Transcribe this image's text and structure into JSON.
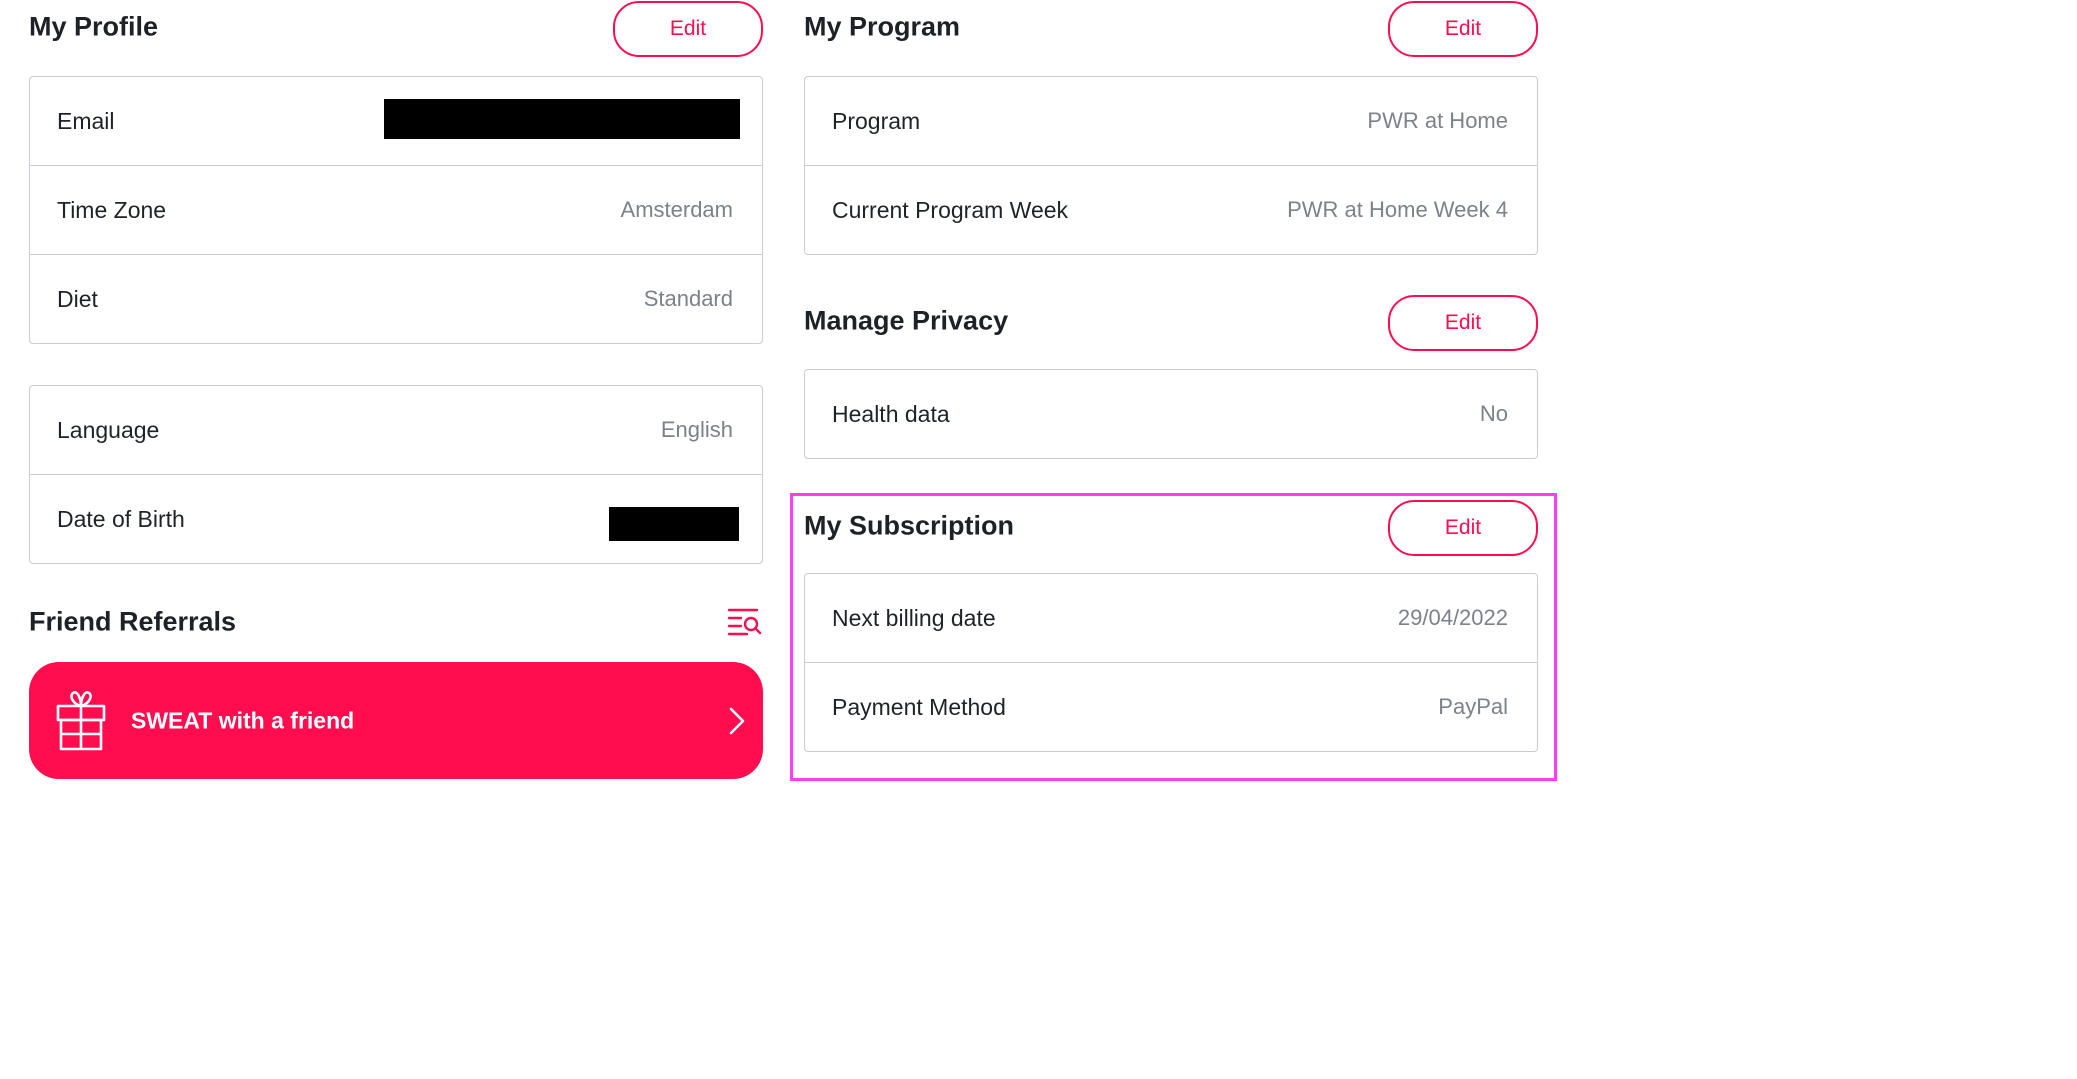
{
  "colors": {
    "accent": "#ff0d4f",
    "highlight": "#ff3df7",
    "text_primary": "#1f2328",
    "text_secondary": "#7d818a",
    "border": "#c9ccd3"
  },
  "profile": {
    "title": "My Profile",
    "edit_label": "Edit",
    "rows": [
      {
        "label": "Email",
        "value": null
      },
      {
        "label": "Time Zone",
        "value": "Amsterdam"
      },
      {
        "label": "Diet",
        "value": "Standard"
      }
    ],
    "rows2": [
      {
        "label": "Language",
        "value": "English"
      },
      {
        "label": "Date of Birth",
        "value": null
      }
    ]
  },
  "referrals": {
    "title": "Friend Referrals",
    "icon": "list-search-icon",
    "card_label": "SWEAT with a friend",
    "card_icon": "gift-icon",
    "card_arrow": "chevron-right-icon"
  },
  "program": {
    "title": "My Program",
    "edit_label": "Edit",
    "rows": [
      {
        "label": "Program",
        "value": "PWR at Home"
      },
      {
        "label": "Current Program Week",
        "value": "PWR at Home Week 4"
      }
    ]
  },
  "privacy": {
    "title": "Manage Privacy",
    "edit_label": "Edit",
    "rows": [
      {
        "label": "Health data",
        "value": "No"
      }
    ]
  },
  "subscription": {
    "title": "My Subscription",
    "edit_label": "Edit",
    "rows": [
      {
        "label": "Next billing date",
        "value": "29/04/2022"
      },
      {
        "label": "Payment Method",
        "value": "PayPal"
      }
    ]
  }
}
